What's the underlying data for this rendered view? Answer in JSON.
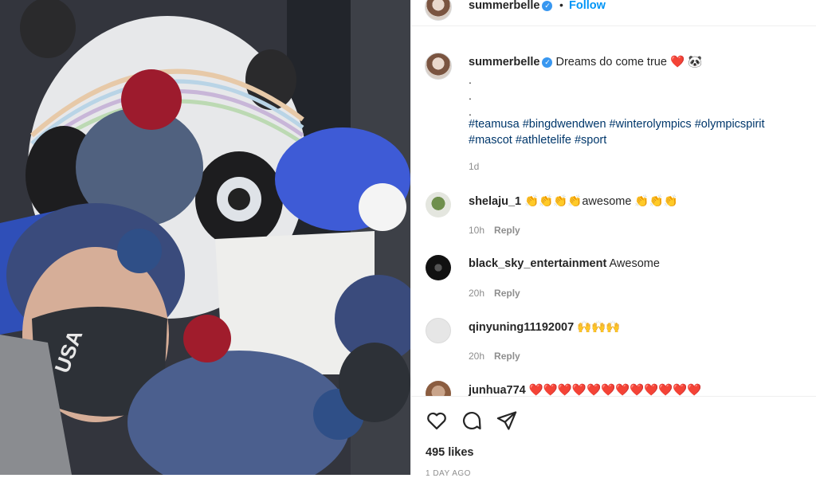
{
  "post": {
    "username": "summerbelle",
    "verified_mark": "✓",
    "dot": "•",
    "follow_label": "Follow",
    "caption": {
      "text": "Dreams do come true ❤️ 🐼",
      "dots": [
        ".",
        ".",
        "."
      ],
      "hashtags": "#teamusa #bingdwendwen #winterolympics #olympicspirit #mascot #athletelife #sport",
      "age": "1d"
    },
    "comments": [
      {
        "username": "shelaju_1",
        "text": "👏👏👏👏awesome 👏👏👏",
        "age": "10h",
        "reply": "Reply"
      },
      {
        "username": "black_sky_entertainment",
        "text": "Awesome",
        "age": "20h",
        "reply": "Reply"
      },
      {
        "username": "qinyuning11192007",
        "text": "🙌🙌🙌",
        "age": "20h",
        "reply": "Reply"
      },
      {
        "username": "junhua774",
        "text": "❤️❤️❤️❤️❤️❤️❤️❤️❤️❤️❤️❤️",
        "age": "",
        "reply": ""
      }
    ],
    "likes": "495 likes",
    "posted": "1 DAY AGO"
  },
  "icons": {
    "like": "heart-icon",
    "comment": "comment-icon",
    "share": "send-icon"
  },
  "colors": {
    "link": "#00376b",
    "follow": "#0095f6",
    "muted": "#8e8e8e",
    "verified": "#3897f0"
  }
}
